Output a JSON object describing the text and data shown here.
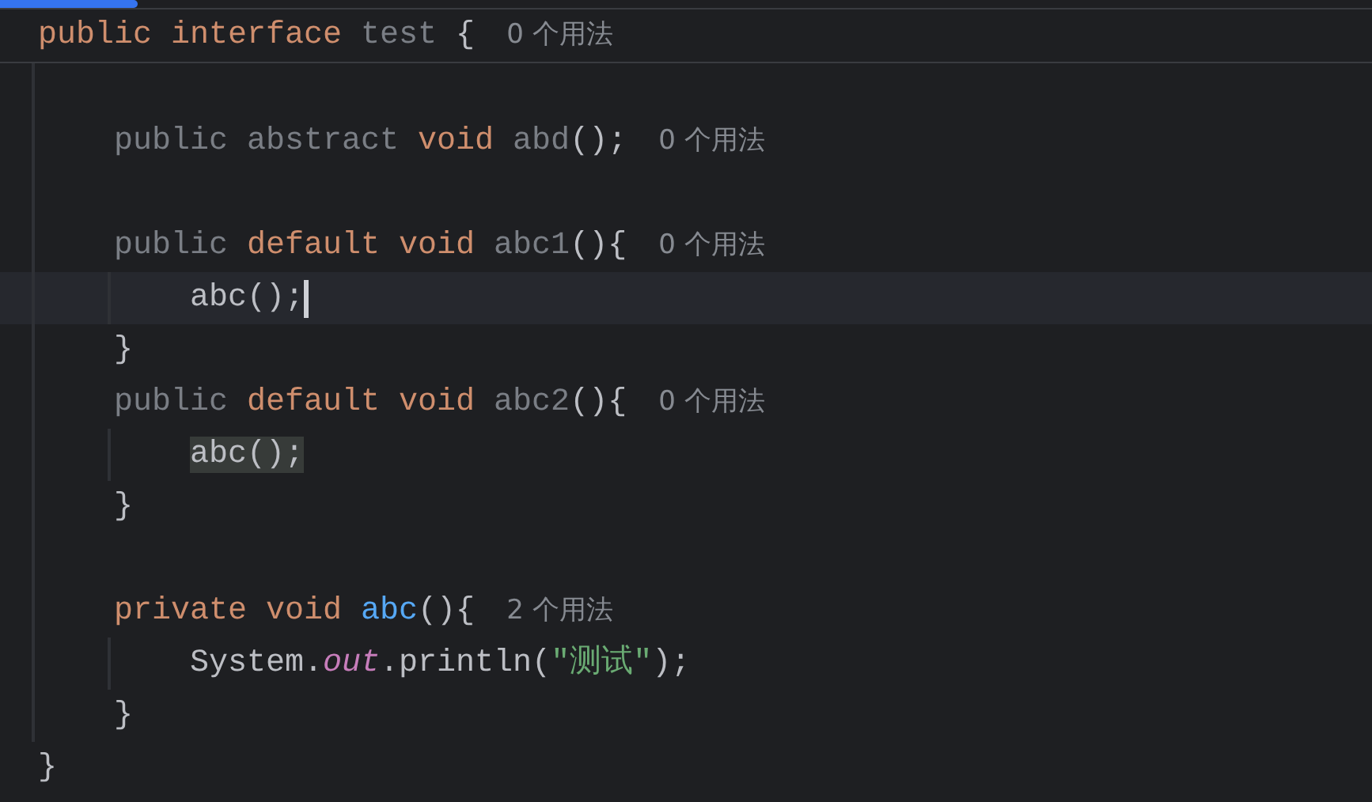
{
  "progress": {
    "level": 0.1
  },
  "header": {
    "tokens": [
      {
        "text": "public interface",
        "kind": "keyword"
      },
      {
        "text": " test",
        "kind": "unused"
      },
      {
        "text": " {",
        "kind": "plain"
      }
    ],
    "hint": "0 个用法"
  },
  "body": [
    {
      "kind": "blank"
    },
    {
      "kind": "line",
      "tokens": [
        {
          "text": "public abstract",
          "kind": "unused"
        },
        {
          "text": " void",
          "kind": "keyword"
        },
        {
          "text": " abd",
          "kind": "unused"
        },
        {
          "text": "();",
          "kind": "plain"
        }
      ],
      "hint": "0 个用法"
    },
    {
      "kind": "blank"
    },
    {
      "kind": "block",
      "header": {
        "tokens": [
          {
            "text": "public",
            "kind": "unused"
          },
          {
            "text": " default void",
            "kind": "keyword"
          },
          {
            "text": " abc1",
            "kind": "unused"
          },
          {
            "text": "(){",
            "kind": "plain"
          }
        ],
        "hint": "0 个用法"
      },
      "children": [
        {
          "kind": "line",
          "current": true,
          "tokens": [
            {
              "text": "abc();",
              "kind": "plain",
              "highlighted": false
            }
          ]
        }
      ],
      "closer": "}"
    },
    {
      "kind": "block",
      "header": {
        "tokens": [
          {
            "text": "public",
            "kind": "unused"
          },
          {
            "text": " default void",
            "kind": "keyword"
          },
          {
            "text": " abc2",
            "kind": "unused"
          },
          {
            "text": "(){",
            "kind": "plain"
          }
        ],
        "hint": "0 个用法"
      },
      "children": [
        {
          "kind": "line",
          "current": false,
          "tokens": [
            {
              "text": "abc();",
              "kind": "plain",
              "highlighted": true
            }
          ]
        }
      ],
      "closer": "}"
    },
    {
      "kind": "blank"
    },
    {
      "kind": "block",
      "header": {
        "tokens": [
          {
            "text": "private void",
            "kind": "keyword"
          },
          {
            "text": " abc",
            "kind": "method"
          },
          {
            "text": "(){",
            "kind": "plain"
          }
        ],
        "hint": "2 个用法"
      },
      "children": [
        {
          "kind": "line",
          "current": false,
          "tokens": [
            {
              "text": "System.",
              "kind": "plain"
            },
            {
              "text": "out",
              "kind": "static"
            },
            {
              "text": ".println(",
              "kind": "plain"
            },
            {
              "text": "\"测试\"",
              "kind": "string"
            },
            {
              "text": ");",
              "kind": "plain"
            }
          ]
        }
      ],
      "closer": "}"
    }
  ],
  "closer": "}"
}
